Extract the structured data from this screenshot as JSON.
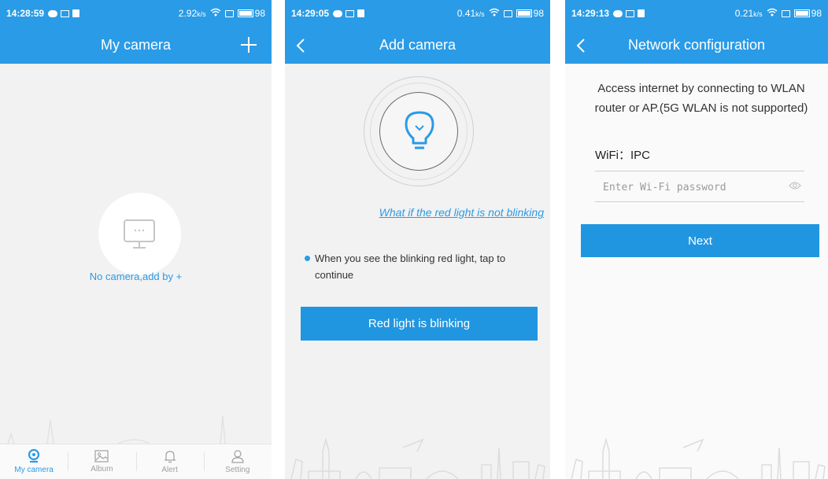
{
  "colors": {
    "accent": "#2a9be6",
    "button": "#2196e0",
    "text": "#333333",
    "muted": "#a0a0a0"
  },
  "screen1": {
    "status": {
      "time": "14:28:59",
      "speed": "2.92",
      "speed_unit": "k/s",
      "battery": "98"
    },
    "title": "My camera",
    "add_icon": "plus-icon",
    "empty_icon": "monitor-icon",
    "empty_text": "No camera,add by +",
    "tabs": [
      {
        "label": "My camera",
        "icon": "camera-icon",
        "active": true
      },
      {
        "label": "Album",
        "icon": "image-icon",
        "active": false
      },
      {
        "label": "Alert",
        "icon": "bell-icon",
        "active": false
      },
      {
        "label": "Setting",
        "icon": "user-icon",
        "active": false
      }
    ]
  },
  "screen2": {
    "status": {
      "time": "14:29:05",
      "speed": "0.41",
      "speed_unit": "k/s",
      "battery": "98"
    },
    "title": "Add camera",
    "bulb_icon": "lightbulb-icon",
    "help_link": "What if the red light is not blinking",
    "instruction": "When you see the blinking red light, tap to continue",
    "button": "Red light is blinking"
  },
  "screen3": {
    "status": {
      "time": "14:29:13",
      "speed": "0.21",
      "speed_unit": "k/s",
      "battery": "98"
    },
    "title": "Network configuration",
    "description": "Access internet by connecting to WLAN router or AP.(5G WLAN is not supported)",
    "wifi_label": "WiFi：IPC",
    "password_placeholder": "Enter Wi-Fi password",
    "eye_icon": "eye-icon",
    "button": "Next"
  }
}
